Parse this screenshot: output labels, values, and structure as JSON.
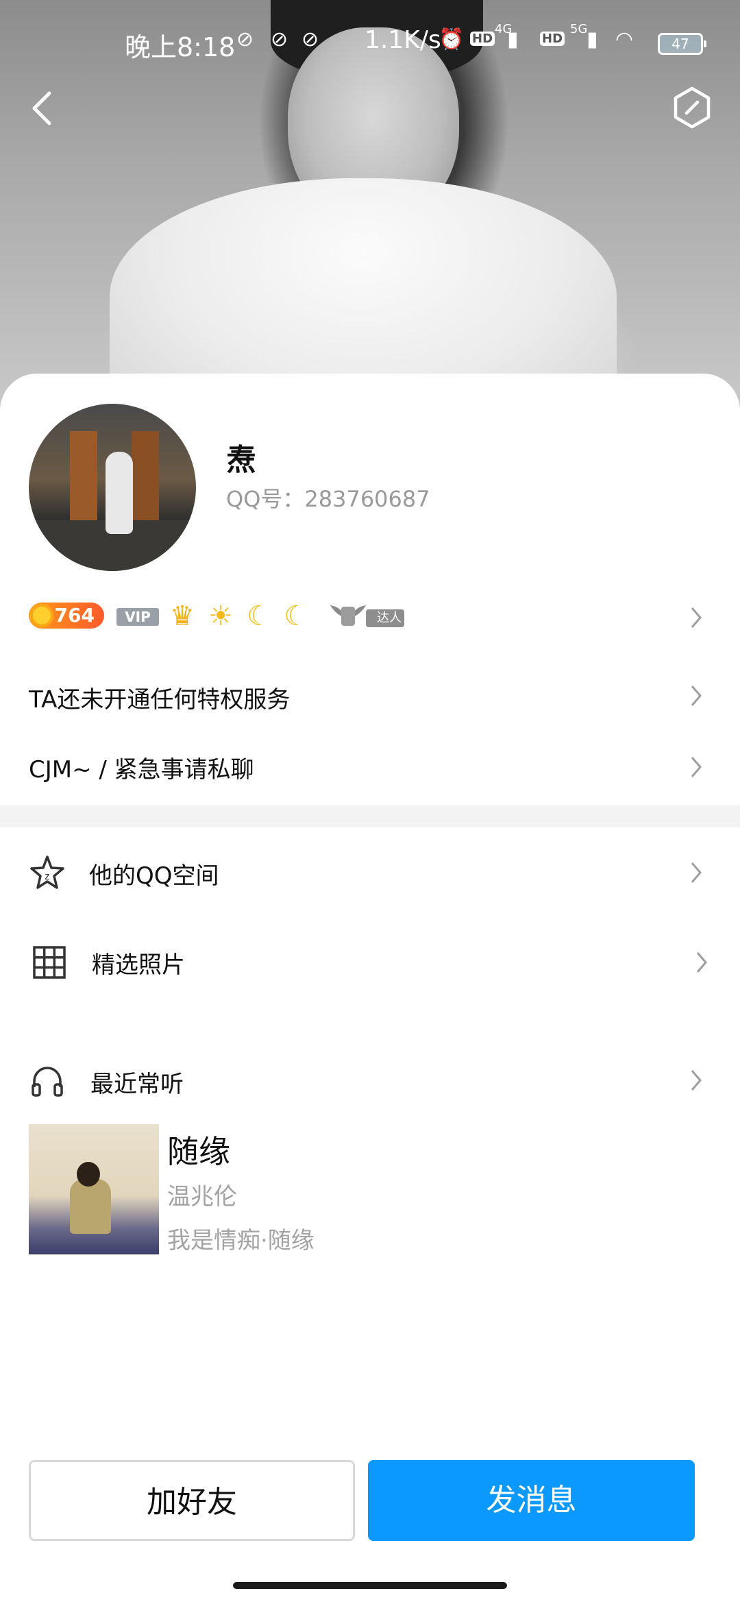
{
  "status_bar": {
    "time": "晚上8:18",
    "net_speed": "1.1K/s",
    "battery": "47",
    "network_4g": "4G",
    "network_5g": "5G",
    "hd1": "HD",
    "hd2": "HD"
  },
  "profile": {
    "name": "焘",
    "qq_label": "QQ号：283760687"
  },
  "badges": {
    "level": "764",
    "vip": "VIP",
    "daren": "达人"
  },
  "rows": {
    "privilege": "TA还未开通任何特权服务",
    "signature": "CJM~ / 紧急事请私聊"
  },
  "list": {
    "qzone": "他的QQ空间",
    "photos": "精选照片",
    "music": "最近常听"
  },
  "song": {
    "title": "随缘",
    "artist": "温兆伦",
    "album": "我是情痴·随缘"
  },
  "actions": {
    "add_friend": "加好友",
    "send_message": "发消息"
  },
  "colors": {
    "primary": "#0b99ff",
    "section_gap": "#f3f3f3"
  }
}
